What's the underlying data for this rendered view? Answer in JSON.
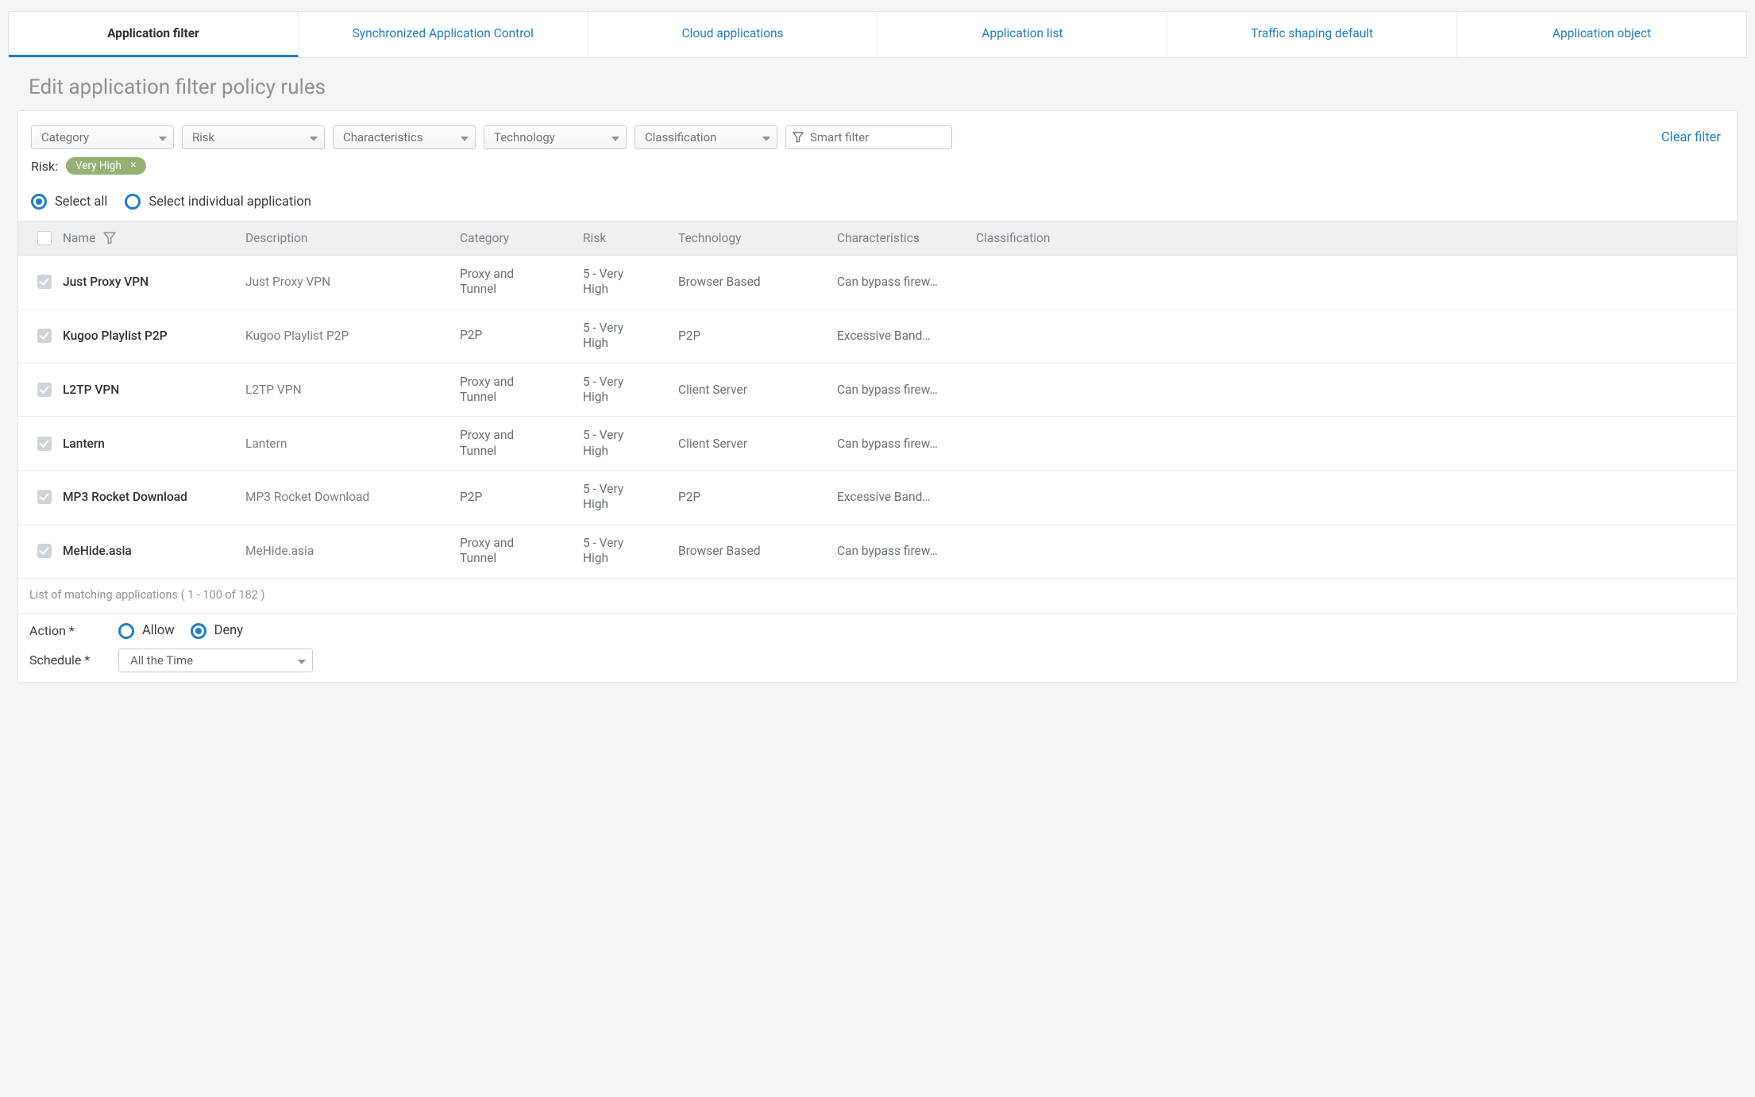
{
  "tabs": [
    {
      "id": "app-filter",
      "label": "Application filter",
      "active": true
    },
    {
      "id": "sync-app-control",
      "label": "Synchronized Application Control",
      "active": false
    },
    {
      "id": "cloud-apps",
      "label": "Cloud applications",
      "active": false
    },
    {
      "id": "app-list",
      "label": "Application list",
      "active": false
    },
    {
      "id": "traffic-shaping",
      "label": "Traffic shaping default",
      "active": false
    },
    {
      "id": "app-object",
      "label": "Application object",
      "active": false
    }
  ],
  "page_title": "Edit application filter policy rules",
  "filters": {
    "dropdowns": {
      "category": "Category",
      "risk": "Risk",
      "characteristics": "Characteristics",
      "technology": "Technology",
      "classification": "Classification"
    },
    "smart_filter_placeholder": "Smart filter",
    "clear_label": "Clear filter",
    "active_filter_label": "Risk:",
    "active_chip": "Very High"
  },
  "selection": {
    "select_all": "Select all",
    "select_individual": "Select individual application",
    "mode": "select_all"
  },
  "columns": {
    "name": "Name",
    "description": "Description",
    "category": "Category",
    "risk": "Risk",
    "technology": "Technology",
    "characteristics": "Characteristics",
    "classification": "Classification"
  },
  "rows": [
    {
      "name": "Just Proxy VPN",
      "description": "Just Proxy VPN",
      "category": "Proxy and Tunnel",
      "risk": "5 - Very High",
      "technology": "Browser Based",
      "characteristics": "Can bypass firew…",
      "classification": ""
    },
    {
      "name": "Kugoo Playlist P2P",
      "description": "Kugoo Playlist P2P",
      "category": "P2P",
      "risk": "5 - Very High",
      "technology": "P2P",
      "characteristics": "Excessive Band…",
      "classification": ""
    },
    {
      "name": "L2TP VPN",
      "description": "L2TP VPN",
      "category": "Proxy and Tunnel",
      "risk": "5 - Very High",
      "technology": "Client Server",
      "characteristics": "Can bypass firew…",
      "classification": ""
    },
    {
      "name": "Lantern",
      "description": "Lantern",
      "category": "Proxy and Tunnel",
      "risk": "5 - Very High",
      "technology": "Client Server",
      "characteristics": "Can bypass firew…",
      "classification": ""
    },
    {
      "name": "MP3 Rocket Download",
      "description": "MP3 Rocket Download",
      "category": "P2P",
      "risk": "5 - Very High",
      "technology": "P2P",
      "characteristics": "Excessive Band…",
      "classification": ""
    },
    {
      "name": "MeHide.asia",
      "description": "MeHide.asia",
      "category": "Proxy and Tunnel",
      "risk": "5 - Very High",
      "technology": "Browser Based",
      "characteristics": "Can bypass firew…",
      "classification": ""
    }
  ],
  "list_footer": "List of matching applications ( 1 - 100 of 182 )",
  "form": {
    "action_label": "Action *",
    "action_allow": "Allow",
    "action_deny": "Deny",
    "action_value": "deny",
    "schedule_label": "Schedule *",
    "schedule_value": "All the Time"
  }
}
